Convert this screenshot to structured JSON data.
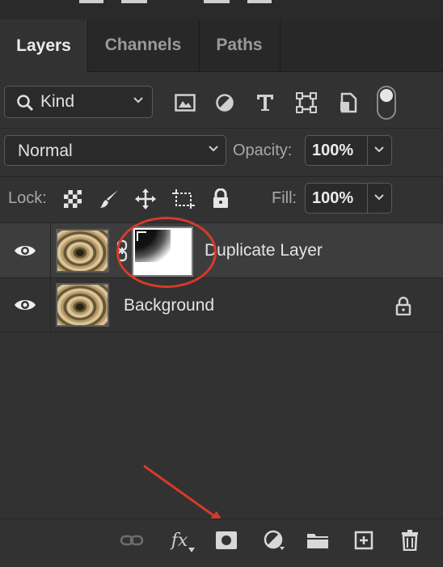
{
  "tabs": [
    {
      "label": "Layers",
      "active": true
    },
    {
      "label": "Channels",
      "active": false
    },
    {
      "label": "Paths",
      "active": false
    }
  ],
  "filter": {
    "kind_label": "Kind",
    "icons": [
      "pixel-layer-filter-icon",
      "adjustment-layer-filter-icon",
      "type-layer-filter-icon",
      "shape-layer-filter-icon",
      "smart-object-filter-icon"
    ]
  },
  "blend": {
    "mode": "Normal",
    "opacity_label": "Opacity:",
    "opacity_value": "100%"
  },
  "lock": {
    "label": "Lock:",
    "fill_label": "Fill:",
    "fill_value": "100%"
  },
  "layers": [
    {
      "name": "Duplicate Layer",
      "selected": true,
      "has_mask": true,
      "locked": false
    },
    {
      "name": "Background",
      "selected": false,
      "has_mask": false,
      "locked": true
    }
  ],
  "bottom_icons": [
    "link-layers-icon",
    "layer-style-fx-icon",
    "add-layer-mask-icon",
    "new-adjustment-layer-icon",
    "new-group-icon",
    "new-layer-icon",
    "delete-layer-icon"
  ],
  "bottom_fx_label": "fx",
  "colors": {
    "panel": "#323232",
    "annotation": "#d63a2a"
  }
}
